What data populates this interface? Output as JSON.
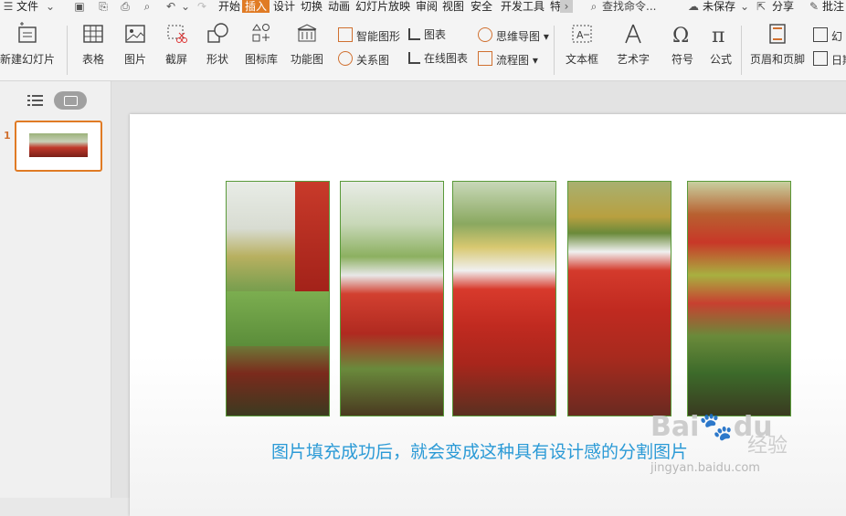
{
  "menubar": {
    "file_label": "文件",
    "tabs": [
      "开始",
      "插入",
      "设计",
      "切换",
      "动画",
      "幻灯片放映",
      "审阅",
      "视图",
      "安全",
      "开发工具",
      "特"
    ],
    "search_label": "查找命令...",
    "unsaved_label": "未保存",
    "share_label": "分享",
    "comment_label": "批注"
  },
  "ribbon": {
    "new_slide": "新建幻灯片",
    "table": "表格",
    "picture": "图片",
    "screenshot": "截屏",
    "shape": "形状",
    "icon_lib": "图标库",
    "function_chart": "功能图",
    "smart_graphic": "智能图形",
    "chart": "图表",
    "relation_chart": "关系图",
    "online_chart": "在线图表",
    "mind_map": "思维导图",
    "flowchart": "流程图",
    "textbox": "文本框",
    "art_text": "艺术字",
    "symbol": "符号",
    "formula": "公式",
    "header_footer": "页眉和页脚",
    "slide_num": "幻",
    "date": "日期"
  },
  "left_pane": {
    "slide_number": "1"
  },
  "slide": {
    "caption": "图片填充成功后，就会变成这种具有设计感的分割图片"
  },
  "watermark": {
    "brand": "Bai",
    "du": "du",
    "jingyan": "经验",
    "url": "jingyan.baidu.com"
  }
}
